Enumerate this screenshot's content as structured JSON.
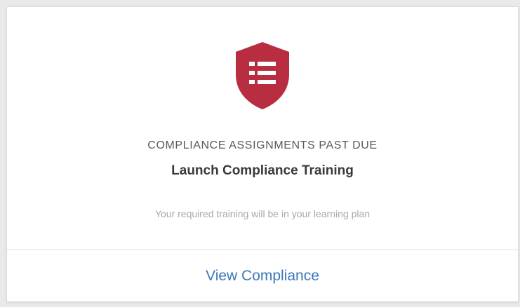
{
  "card": {
    "icon": "shield-list-icon",
    "overline": "COMPLIANCE ASSIGNMENTS PAST DUE",
    "title": "Launch Compliance Training",
    "description": "Your required training will be in your learning plan",
    "action_label": "View Compliance"
  },
  "colors": {
    "shield": "#b82d3f",
    "link": "#3b78b9"
  }
}
